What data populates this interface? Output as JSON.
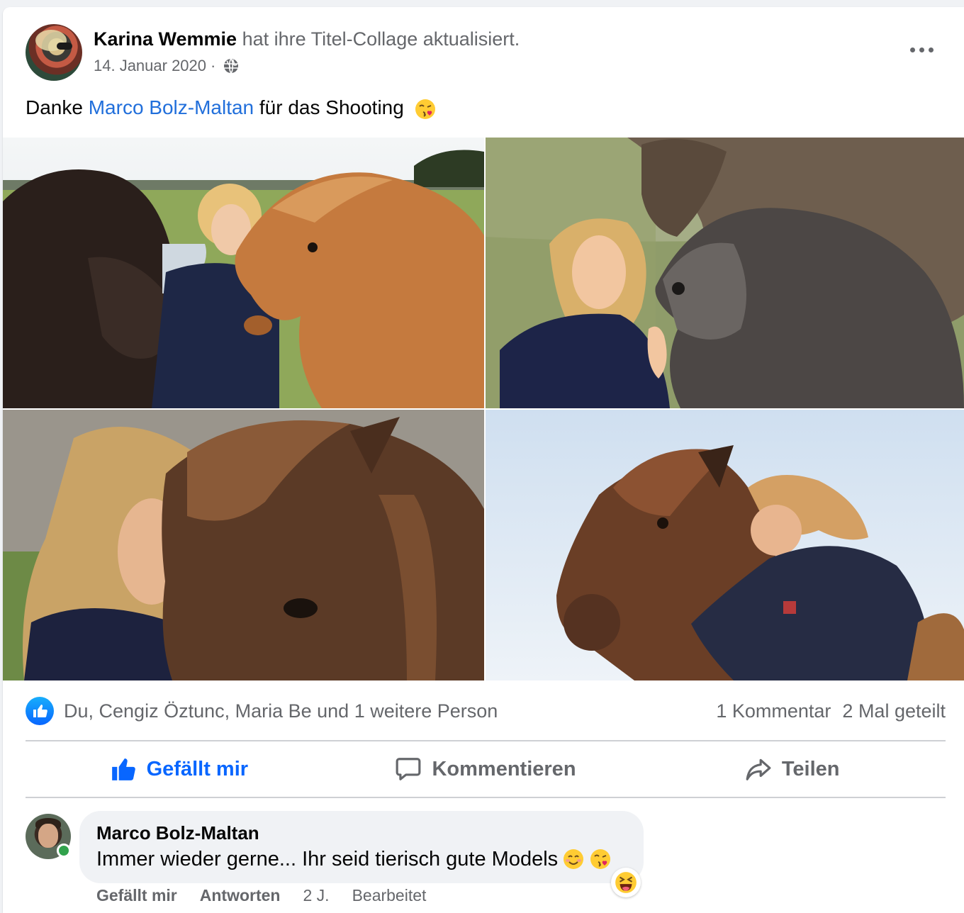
{
  "post": {
    "author": "Karina Wemmie",
    "action": "hat ihre Titel-Collage aktualisiert.",
    "date": "14. Januar 2020",
    "separator": "·",
    "text_before": "Danke ",
    "mention": "Marco Bolz-Maltan",
    "text_after": " für das Shooting"
  },
  "reactions": {
    "summary": "Du, Cengiz Öztunc, Maria Be und 1 weitere Person",
    "comments": "1 Kommentar",
    "shares": "2 Mal geteilt"
  },
  "actions": {
    "like": "Gefällt mir",
    "comment": "Kommentieren",
    "share": "Teilen"
  },
  "comment": {
    "author": "Marco Bolz-Maltan",
    "text": "Immer wieder gerne... Ihr seid tierisch gute Models",
    "like": "Gefällt mir",
    "reply": "Antworten",
    "age": "2 J.",
    "edited": "Bearbeitet"
  },
  "colors": {
    "brand_blue": "#0866ff",
    "mention_blue": "#216fdb",
    "secondary_text": "#65676b",
    "online_green": "#31a24c"
  },
  "icons": [
    "globe-icon",
    "more-icon",
    "kiss-emoji",
    "like-reaction-icon",
    "thumbs-up-icon",
    "comment-icon",
    "share-icon",
    "smile-emoji",
    "laugh-emoji"
  ]
}
